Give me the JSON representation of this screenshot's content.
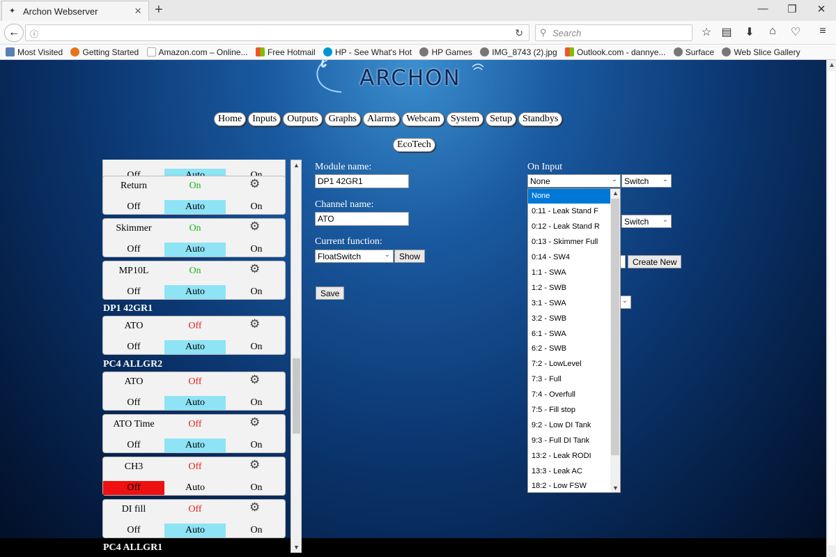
{
  "browser": {
    "tab_title": "Archon Webserver",
    "search_placeholder": "Search",
    "bookmarks": [
      "Most Visited",
      "Getting Started",
      "Amazon.com – Online...",
      "Free Hotmail",
      "HP - See What's Hot",
      "HP Games",
      "IMG_8743 (2).jpg",
      "Outlook.com - dannye...",
      "Surface",
      "Web Slice Gallery"
    ]
  },
  "logo": {
    "text": "ARCHON"
  },
  "nav": {
    "buttons": [
      "Home",
      "Inputs",
      "Outputs",
      "Graphs",
      "Alarms",
      "Webcam",
      "System",
      "Setup",
      "Standbys"
    ],
    "eco": "EcoTech"
  },
  "outlets": {
    "top_partial": {
      "off": "Off",
      "auto": "Auto",
      "on": "On"
    },
    "cards": [
      {
        "name": "Return",
        "state": "On",
        "off": "Off",
        "auto": "Auto",
        "on": "On"
      },
      {
        "name": "Skimmer",
        "state": "On",
        "off": "Off",
        "auto": "Auto",
        "on": "On"
      },
      {
        "name": "MP10L",
        "state": "On",
        "off": "Off",
        "auto": "Auto",
        "on": "On"
      },
      {
        "name": "ATO",
        "state": "Off",
        "off": "Off",
        "auto": "Auto",
        "on": "On"
      },
      {
        "name": "ATO",
        "state": "Off",
        "off": "Off",
        "auto": "Auto",
        "on": "On"
      },
      {
        "name": "ATO Time",
        "state": "Off",
        "off": "Off",
        "auto": "Auto",
        "on": "On"
      },
      {
        "name": "CH3",
        "state": "Off",
        "off": "Off",
        "auto": "Auto",
        "on": "On"
      },
      {
        "name": "DI fill",
        "state": "Off",
        "off": "Off",
        "auto": "Auto",
        "on": "On"
      }
    ],
    "sections": [
      "DP1 42GR1",
      "PC4 ALLGR2",
      "PC4 ALLGR1"
    ]
  },
  "form": {
    "module_label": "Module name:",
    "module_value": "DP1 42GR1",
    "channel_label": "Channel name:",
    "channel_value": "ATO",
    "function_label": "Current function:",
    "function_value": "FloatSwitch",
    "show_label": "Show",
    "save_label": "Save",
    "on_input_label": "On Input",
    "on_input_value": "None",
    "switch1": "Switch",
    "switch2": "Switch",
    "create_new": "Create New"
  },
  "dropdown": {
    "options": [
      "None",
      "0:11 - Leak Stand F",
      "0:12 - Leak Stand R",
      "0:13 - Skimmer Full",
      "0:14 - SW4",
      "1:1 - SWA",
      "1:2 - SWB",
      "3:1 - SWA",
      "3:2 - SWB",
      "6:1 - SWA",
      "6:2 - SWB",
      "7:2 - LowLevel",
      "7:3 - Full",
      "7:4 - Overfull",
      "7:5 - Fill stop",
      "9:2 - Low DI Tank",
      "9:3 - Full DI Tank",
      "13:2 - Leak RODI",
      "13:3 - Leak AC",
      "18:2 - Low FSW"
    ]
  },
  "colors": {
    "accent_auto": "#8ee3f5",
    "state_on": "#14b814",
    "state_off": "#f01a1a",
    "selected": "#0078d7"
  }
}
